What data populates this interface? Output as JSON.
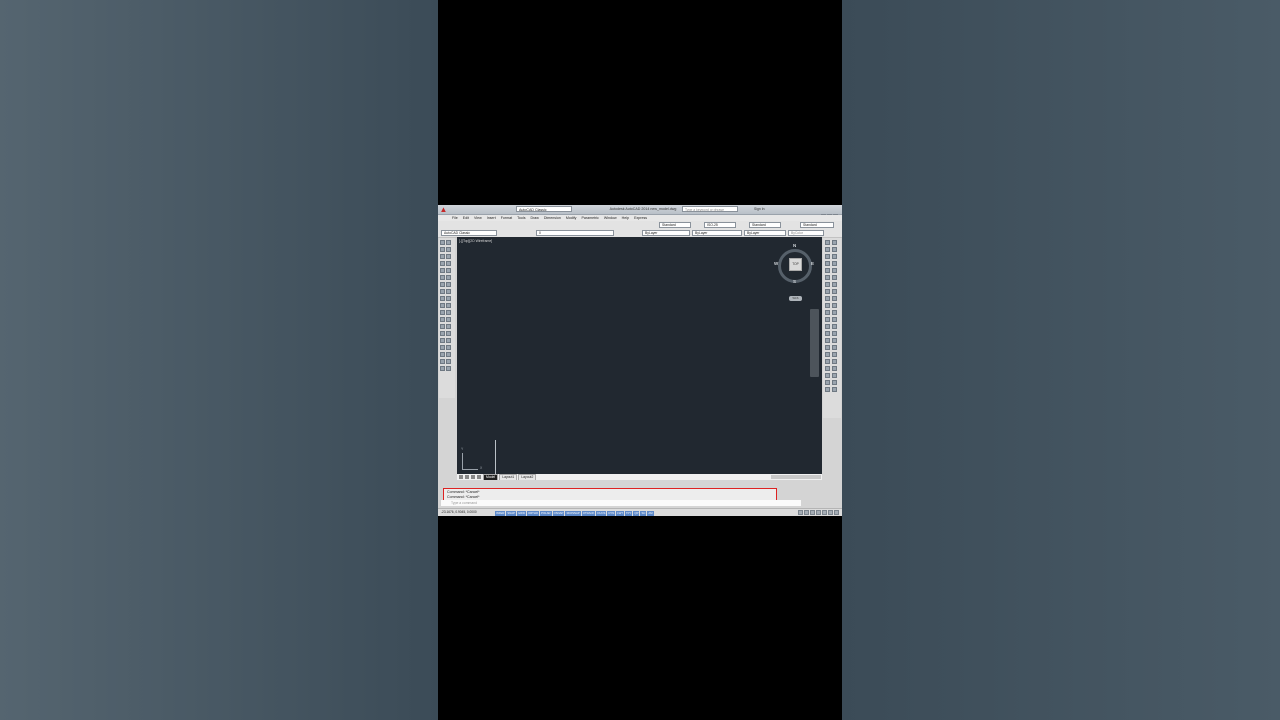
{
  "app": {
    "title_text": "Autodesk AutoCAD 2014  new_model.dwg",
    "workspace": "AutoCAD Classic",
    "search_placeholder": "Type a keyword or phrase",
    "signin": "Sign In"
  },
  "menu": [
    "File",
    "Edit",
    "View",
    "Insert",
    "Format",
    "Tools",
    "Draw",
    "Dimension",
    "Modify",
    "Parametric",
    "Window",
    "Help",
    "Express"
  ],
  "toolbar_fields": {
    "text_style": "Standard",
    "dim_style": "ISO-25",
    "table_style": "Standard",
    "mleader_style": "Standard",
    "workspace2": "AutoCAD Classic",
    "layer": "0",
    "color": "ByLayer",
    "linetype": "ByLayer",
    "lineweight": "ByLayer",
    "plotstyle": "ByColor"
  },
  "viewport": {
    "label": "[-][Top][2D Wireframe]",
    "viewcube": {
      "face": "TOP",
      "north": "N",
      "south": "S",
      "east": "E",
      "west": "W"
    },
    "wcs": "WCS",
    "ucs_x": "X",
    "ucs_y": "Y"
  },
  "tabs": {
    "model": "Model",
    "layout1": "Layout1",
    "layout2": "Layout2"
  },
  "command": {
    "line1": "Command:  *Cancel*",
    "line2": "Command:  *Cancel*",
    "input_placeholder": "Type a command"
  },
  "status": {
    "coords": "-23.1676,  0.9045, 0.0000",
    "buttons": [
      "INFER",
      "SNAP",
      "GRID",
      "ORTHO",
      "POLAR",
      "OSNAP",
      "3DOSNAP",
      "OTRACK",
      "DUCS",
      "DYN",
      "LWT",
      "TPY",
      "QP",
      "SC",
      "AM"
    ]
  },
  "colors": {
    "viewport_bg": "#212830",
    "highlight_border": "#dd2222",
    "accent": "#c62828"
  }
}
